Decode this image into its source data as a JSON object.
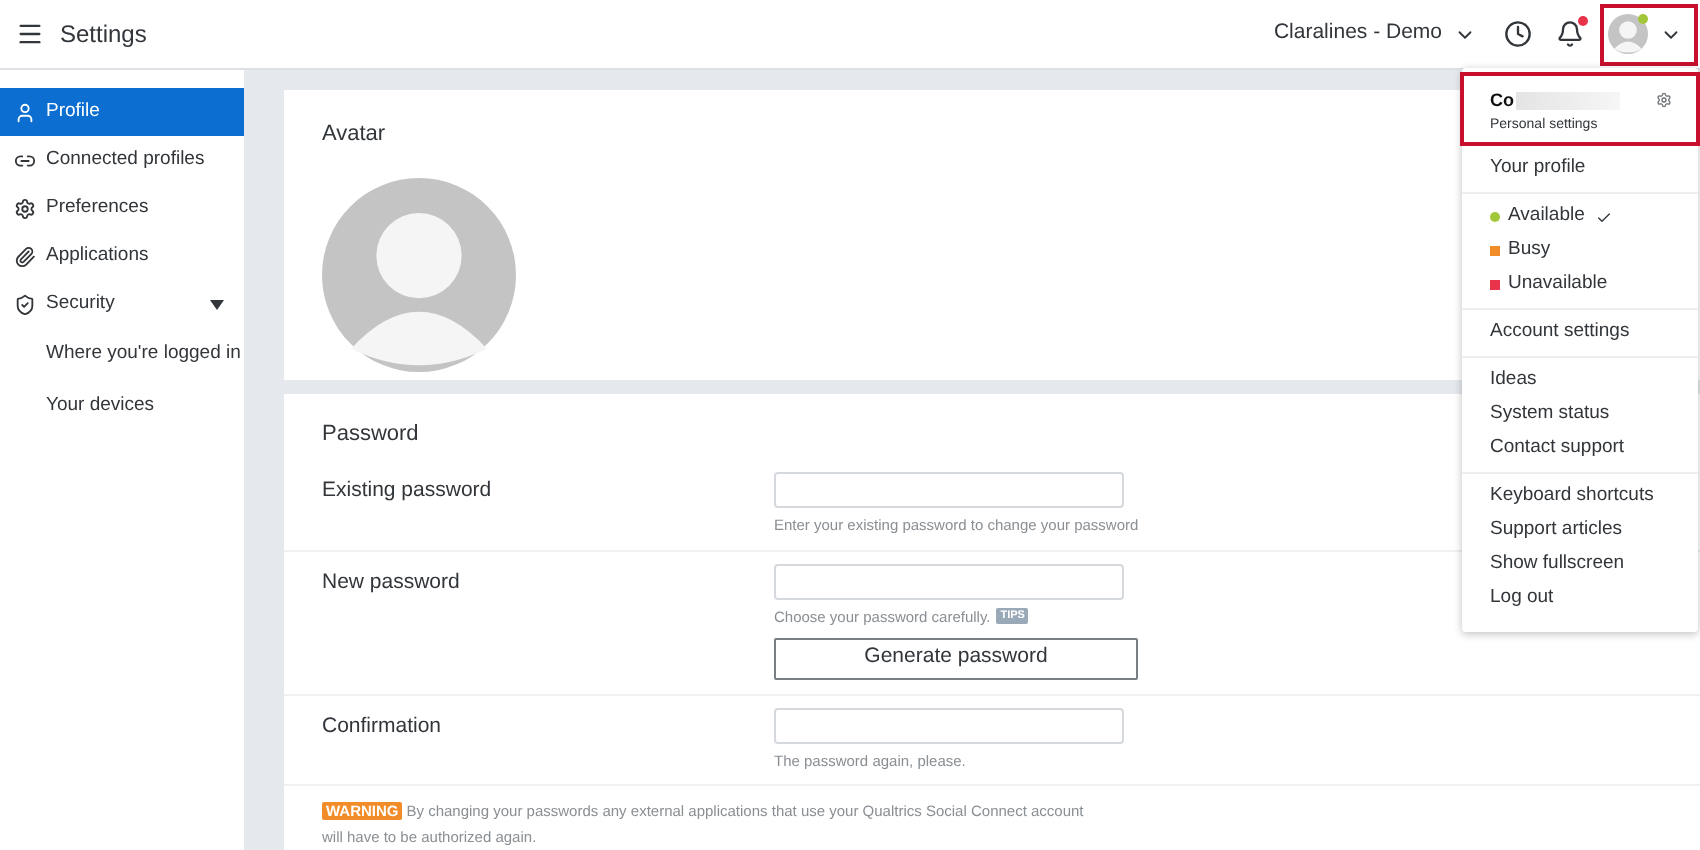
{
  "header": {
    "title": "Settings",
    "account": "Claralines - Demo",
    "notification_unread": true
  },
  "sidebar": {
    "items": [
      {
        "label": "Profile",
        "selected": true
      },
      {
        "label": "Connected profiles",
        "selected": false
      },
      {
        "label": "Preferences",
        "selected": false
      },
      {
        "label": "Applications",
        "selected": false
      },
      {
        "label": "Security",
        "selected": false,
        "expanded": true,
        "children": [
          {
            "label": "Where you're logged in",
            "selected": false
          },
          {
            "label": "Your devices",
            "selected": false
          }
        ]
      }
    ]
  },
  "avatar_section": {
    "title": "Avatar"
  },
  "password_section": {
    "title": "Password",
    "fields": [
      {
        "label": "Existing password",
        "hint": "Enter your existing password to change your password"
      },
      {
        "label": "New password",
        "hint": "Choose your password carefully.",
        "tag": "TIPS",
        "button": "Generate password"
      },
      {
        "label": "Confirmation",
        "hint": "The password again, please."
      }
    ],
    "warning": {
      "badge": "WARNING",
      "text": "By changing your passwords any external applications that use your Qualtrics Social Connect account will have to be authorized again."
    }
  },
  "menu": {
    "user": {
      "name": "Co",
      "subtitle": "Personal settings"
    },
    "groups": [
      [
        {
          "kind": "link",
          "label": "Your profile"
        }
      ],
      [
        {
          "kind": "status",
          "label": "Available",
          "color": "#a3c73a",
          "selected": true
        },
        {
          "kind": "status",
          "label": "Busy",
          "color": "#f28c28",
          "selected": false
        },
        {
          "kind": "status",
          "label": "Unavailable",
          "color": "#e8334a",
          "selected": false
        }
      ],
      [
        {
          "kind": "link",
          "label": "Account settings"
        }
      ],
      [
        {
          "kind": "link",
          "label": "Ideas"
        },
        {
          "kind": "link",
          "label": "System status"
        },
        {
          "kind": "link",
          "label": "Contact support"
        }
      ],
      [
        {
          "kind": "link",
          "label": "Keyboard shortcuts"
        },
        {
          "kind": "link",
          "label": "Support articles"
        },
        {
          "kind": "link",
          "label": "Show fullscreen"
        },
        {
          "kind": "link",
          "label": "Log out"
        }
      ]
    ]
  }
}
